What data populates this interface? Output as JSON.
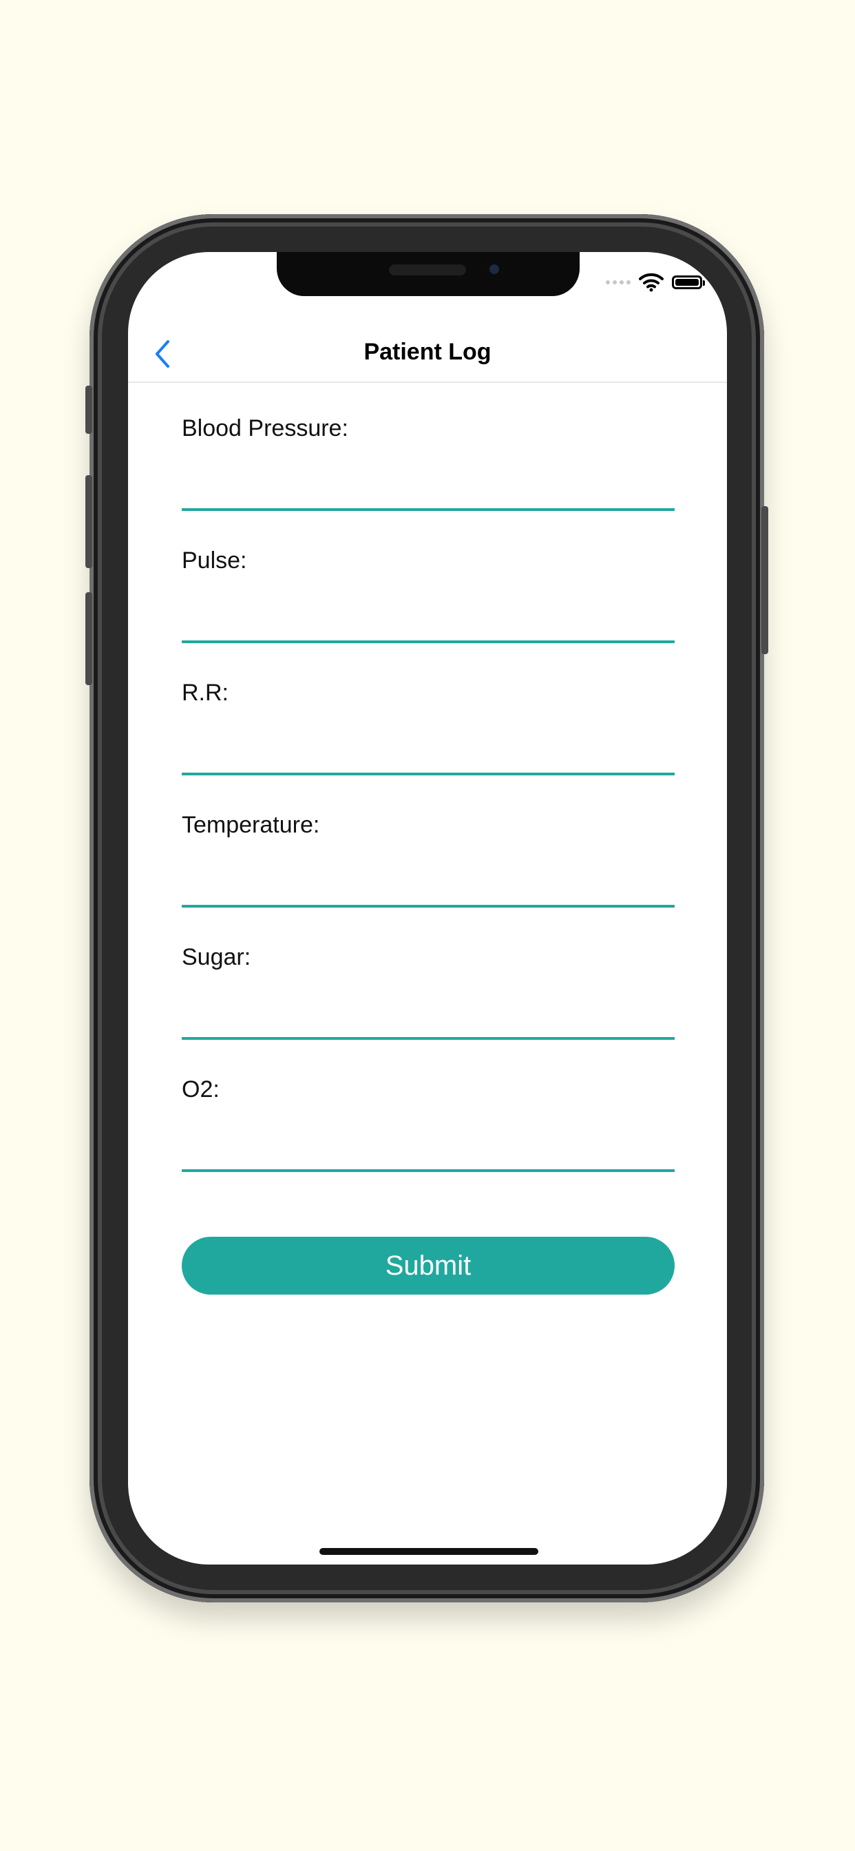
{
  "nav": {
    "title": "Patient Log",
    "back_icon": "chevron-left-icon"
  },
  "status_bar": {
    "icons": [
      "signal-icon",
      "wifi-icon",
      "battery-icon"
    ]
  },
  "form": {
    "fields": [
      {
        "label": "Blood Pressure:",
        "value": ""
      },
      {
        "label": "Pulse:",
        "value": ""
      },
      {
        "label": "R.R:",
        "value": ""
      },
      {
        "label": "Temperature:",
        "value": ""
      },
      {
        "label": "Sugar:",
        "value": ""
      },
      {
        "label": "O2:",
        "value": ""
      }
    ],
    "submit_label": "Submit"
  },
  "colors": {
    "accent": "#20a89e",
    "back_icon": "#1a7ef6",
    "background": "#fffdee"
  }
}
